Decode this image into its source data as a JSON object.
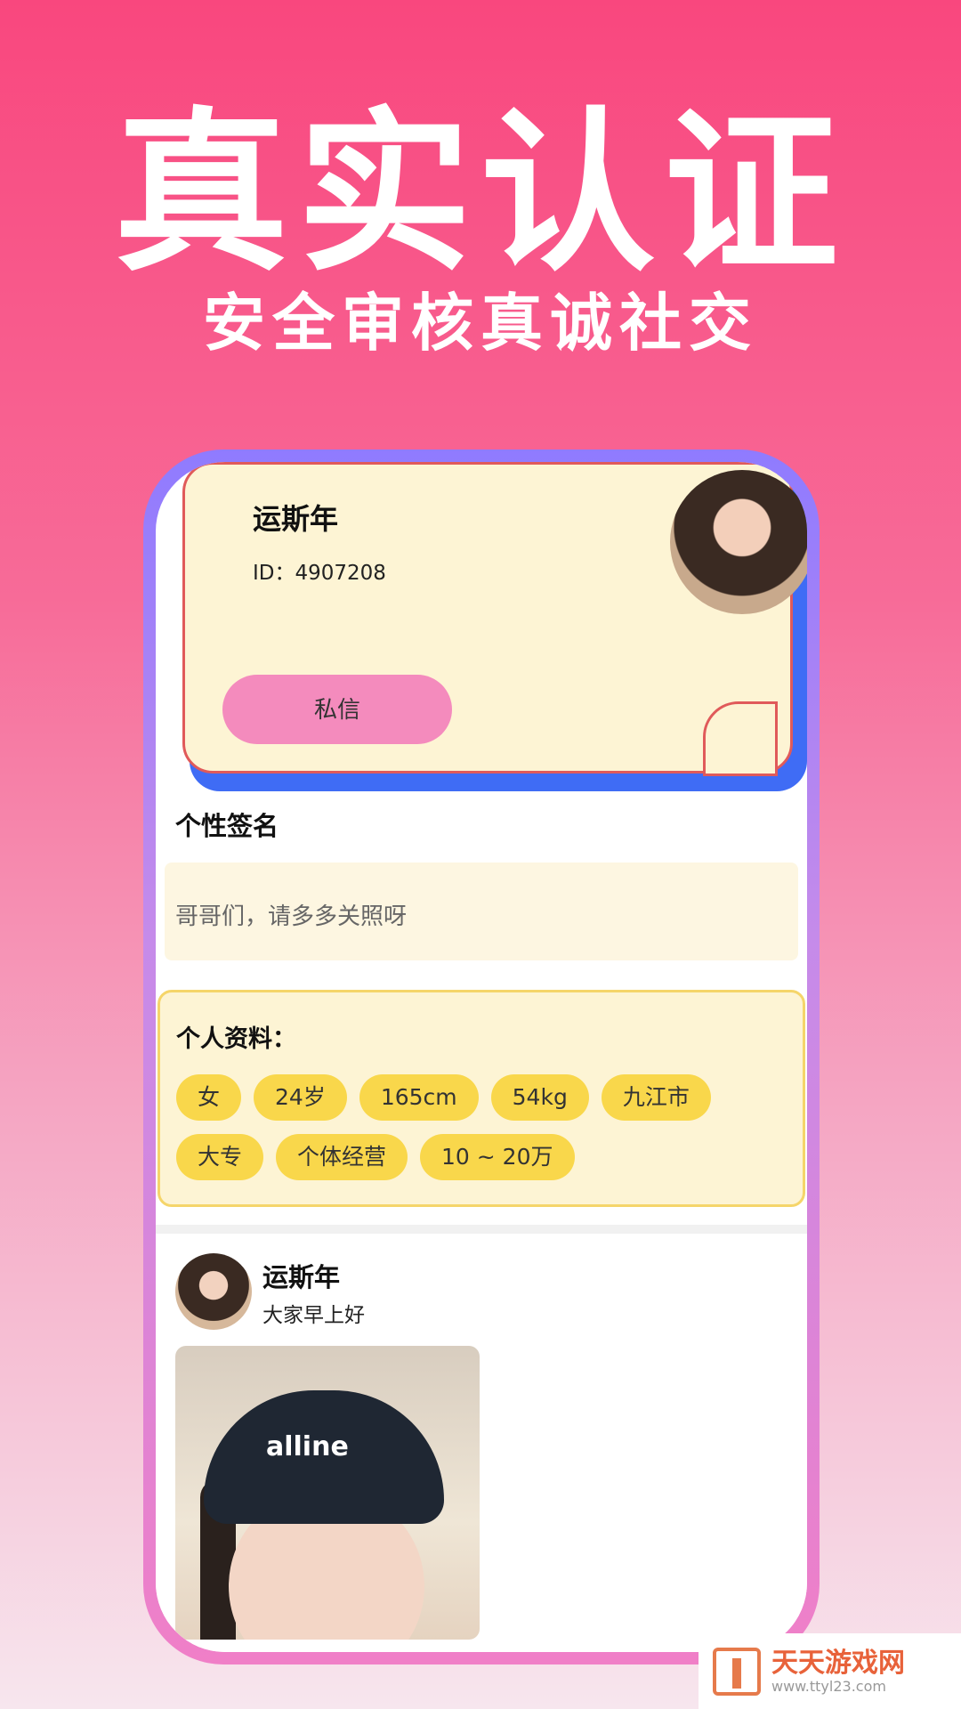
{
  "hero": {
    "title": "真实认证",
    "subtitle": "安全审核真诚社交"
  },
  "profile": {
    "name": "运斯年",
    "id_label": "ID：4907208",
    "message_button": "私信"
  },
  "signature": {
    "title": "个性签名",
    "text": "哥哥们，请多多关照呀"
  },
  "personal_info": {
    "title": "个人资料：",
    "tags": [
      "女",
      "24岁",
      "165cm",
      "54kg",
      "九江市",
      "大专",
      "个体经营",
      "10 ~ 20万"
    ]
  },
  "post": {
    "name": "运斯年",
    "text": "大家早上好",
    "cap_logo": "alline"
  },
  "watermark": {
    "title": "天天游戏网",
    "url": "www.ttyl23.com"
  },
  "colors": {
    "accent_pink": "#f9477e",
    "button_pink": "#f48bbd",
    "tag_yellow": "#f9d74b",
    "card_bg": "#fdf4d4",
    "card_shadow_blue": "#3f6cf5"
  }
}
